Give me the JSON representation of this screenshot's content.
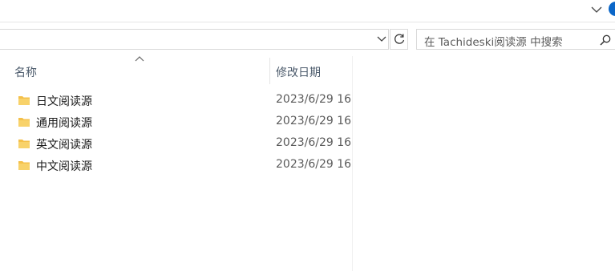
{
  "search": {
    "placeholder": "在 Tachideski阅读源 中搜索"
  },
  "columns": {
    "name": "名称",
    "date_modified": "修改日期"
  },
  "files": [
    {
      "name": "日文阅读源",
      "date": "2023/6/29 16:",
      "icon": "folder-icon"
    },
    {
      "name": "通用阅读源",
      "date": "2023/6/29 16:",
      "icon": "folder-icon"
    },
    {
      "name": "英文阅读源",
      "date": "2023/6/29 16:",
      "icon": "folder-icon"
    },
    {
      "name": "中文阅读源",
      "date": "2023/6/29 16:",
      "icon": "folder-icon"
    }
  ],
  "colors": {
    "folder": "#f4c04a",
    "accent": "#0a66c8",
    "header_text": "#4b5a6b"
  }
}
